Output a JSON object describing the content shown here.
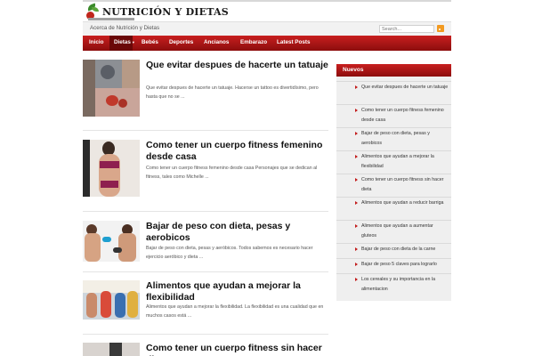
{
  "site": {
    "logo_text": "NUTRICIÓN Y DIETAS"
  },
  "subbar": {
    "link": "Acerca de Nutrición y Dietas"
  },
  "search": {
    "placeholder": "Search..."
  },
  "nav": {
    "items": [
      {
        "label": "Inicio"
      },
      {
        "label": "Dietas"
      },
      {
        "label": "Bebés"
      },
      {
        "label": "Deportes"
      },
      {
        "label": "Ancianos"
      },
      {
        "label": "Embarazo"
      },
      {
        "label": "Latest Posts"
      }
    ]
  },
  "posts": [
    {
      "title": "Que evitar despues de hacerte un tatuaje",
      "excerpt": "Que evitar despues de hacerte un tatuaje. Hacerse un tattoo es divertidísimo, pero hasta que no se ..."
    },
    {
      "title": "Como tener un cuerpo fitness femenino desde casa",
      "excerpt": "Como tener un cuerpo fitness femenino desde casa Personajes que se dedican al fitness, tales como Michelle ..."
    },
    {
      "title": "Bajar de peso con dieta, pesas y aerobicos",
      "excerpt": "Bajar de peso con dieta, pesas y aeróbicos. Todos sabemos es necesario hacer ejercicio aeróbico y dieta ..."
    },
    {
      "title": "Alimentos que ayudan a mejorar la flexibilidad",
      "excerpt": "Alimentos que ayudan a mejorar la flexibilidad. La flexibilidad es una cualidad que en muchos casos está ..."
    },
    {
      "title": "Como tener un cuerpo fitness sin hacer dieta",
      "excerpt": ""
    }
  ],
  "sidebar": {
    "heading": "Nuevos",
    "items": [
      {
        "label": "Que evitar despues de hacerte un tatuaje"
      },
      {
        "label": "Como tener un cuerpo fitness femenino desde casa"
      },
      {
        "label": "Bajar de peso con dieta, pesas y aerobicos"
      },
      {
        "label": "Alimentos que ayudan a mejorar la flexibilidad"
      },
      {
        "label": "Como tener un cuerpo fitness sin hacer dieta"
      },
      {
        "label": "Alimentos que ayudan a reducir barriga"
      },
      {
        "label": "Alimentos que ayudan a aumentar gluteos"
      },
      {
        "label": "Bajar de peso con dieta de la carne"
      },
      {
        "label": "Bajar de peso 5 claves para lograrlo"
      },
      {
        "label": "Los cereales y su importancia en la alimentacion"
      }
    ]
  },
  "colors": {
    "brand_red": "#c81f1f",
    "brand_red_dark": "#8c0d0d",
    "rss_orange": "#f29a20"
  }
}
